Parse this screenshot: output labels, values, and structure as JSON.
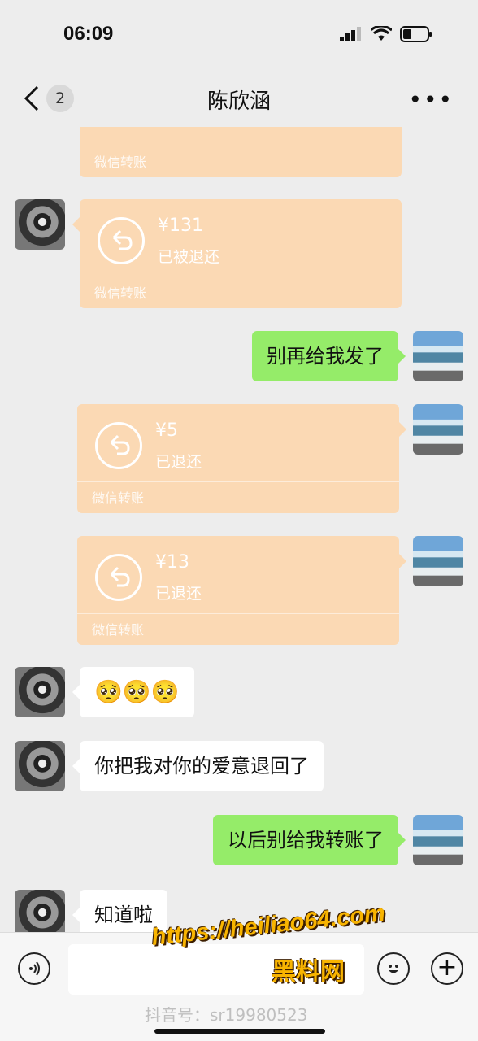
{
  "status": {
    "time": "06:09"
  },
  "nav": {
    "back_badge": "2",
    "title": "陈欣涵",
    "more": "•••"
  },
  "messages": {
    "transfer_top": {
      "caption": "微信转账"
    },
    "transfer_1": {
      "amount": "¥131",
      "status": "已被退还",
      "caption": "微信转账"
    },
    "text_1": "别再给我发了",
    "transfer_2": {
      "amount": "¥5",
      "status": "已退还",
      "caption": "微信转账"
    },
    "transfer_3": {
      "amount": "¥13",
      "status": "已退还",
      "caption": "微信转账"
    },
    "emoji_msg": "🥺🥺🥺",
    "text_2": "你把我对你的爱意退回了",
    "text_3": "以后别给我转账了",
    "text_4": "知道啦"
  },
  "watermarks": {
    "url": "https://heiliao64.com",
    "site_name": "黑料网",
    "tiktok": "抖音号：sr19980523"
  },
  "icons": {
    "back": "chevron-left-icon",
    "more": "more-dots-icon",
    "voice": "voice-icon",
    "emoji": "emoji-icon",
    "plus": "plus-icon"
  },
  "colors": {
    "background": "#ededed",
    "transfer_bubble": "#fbd9b4",
    "sent_bubble": "#95ec69",
    "received_bubble": "#ffffff"
  }
}
